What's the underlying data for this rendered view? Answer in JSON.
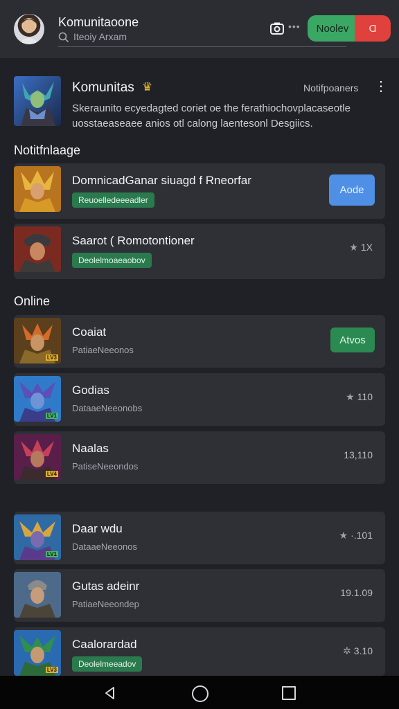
{
  "header": {
    "title": "Komunitaoone",
    "search_text": "Iteoiy Arxam",
    "dots": "•••",
    "accept_label": "Noolev",
    "decline_label": "Ɑ"
  },
  "community": {
    "name": "Komunitas",
    "notif_label": "Notifpoaners",
    "description": "Skeraunito ecyedagted coriet oe the ferathiochovplacaseotle uosstaeaseaee anios otl calong laentesonl Desgiics."
  },
  "sections": {
    "notifications": "Notitfnlaage",
    "online": "Online"
  },
  "notifications": [
    {
      "title": "DomnicadGanar siuagd f Rneorfar",
      "tag": "Reuoelledeeeadler",
      "button": "Aode"
    },
    {
      "title": "Saarot ( Romotontioner",
      "tag": "Deolelmoaeaobov",
      "meta": "1X"
    }
  ],
  "online": [
    {
      "title": "Coaiat",
      "sub": "PatiaeNeeonos",
      "button": "Atvos",
      "level": "LV3"
    },
    {
      "title": "Godias",
      "sub": "DataaeNeeonobs",
      "meta": "110",
      "level": "LV1"
    },
    {
      "title": "Naalas",
      "sub": "PatiseNeeondos",
      "meta": "13,110",
      "level": "LV4"
    }
  ],
  "others": [
    {
      "title": "Daar wdu",
      "sub": "DataaeNeeonos",
      "meta": "·.101",
      "level": "LV1"
    },
    {
      "title": "Gutas adeinr",
      "sub": "PatiaeNeeondep",
      "meta": "19.1.09"
    },
    {
      "title": "Caalorardad",
      "tag": "Deolelmeeadov",
      "meta": "3.10",
      "level": "LV3"
    }
  ],
  "colors": {
    "accent_blue": "#4f8fe6",
    "accent_green": "#2b8a52",
    "decline_red": "#e0413c",
    "background": "#1f2126"
  },
  "icons": [
    "search-icon",
    "camera-icon",
    "crown-icon",
    "more-vertical-icon",
    "star-icon",
    "back-icon",
    "home-icon",
    "recents-icon"
  ]
}
